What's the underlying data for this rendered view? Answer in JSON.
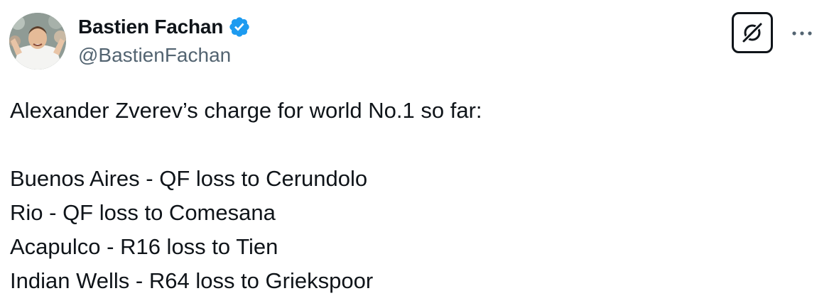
{
  "author": {
    "name": "Bastien Fachan",
    "handle": "@BastienFachan",
    "verified": true,
    "verified_color": "#1d9bf0"
  },
  "actions": {
    "grok_icon": "grok-icon",
    "more_icon": "more-horizontal-icon"
  },
  "tweet": {
    "intro": "Alexander Zverev’s charge for world No.1 so far:",
    "lines": [
      "Buenos Aires - QF loss to Cerundolo",
      "Rio - QF loss to Comesana",
      "Acapulco - R16 loss to Tien",
      "Indian Wells - R64 loss to Griekspoor"
    ]
  },
  "colors": {
    "text": "#0f1419",
    "secondary": "#536471",
    "accent": "#1d9bf0"
  }
}
